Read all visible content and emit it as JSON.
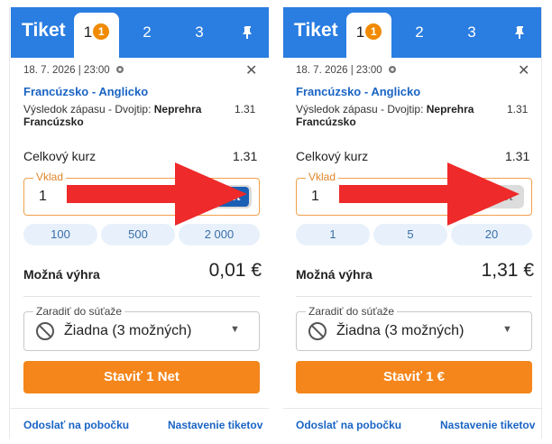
{
  "panels": [
    {
      "header": {
        "title": "Tiket",
        "tabs": [
          "1",
          "2",
          "3"
        ],
        "badge": "1"
      },
      "bet": {
        "datetime": "18. 7. 2026 | 23:00",
        "match": "Francúzsko - Anglicko",
        "market": "Výsledok zápasu - Dvojtip:",
        "selection": "Neprehra Francúzsko",
        "odds": "1.31"
      },
      "total": {
        "label": "Celkový kurz",
        "value": "1.31"
      },
      "stake": {
        "label": "Vklad",
        "value": "1",
        "currency_label": "€",
        "net_label": "Net",
        "active": "Net"
      },
      "quick_stakes": [
        "100",
        "500",
        "2 000"
      ],
      "win": {
        "label": "Možná výhra",
        "value": "0,01 €"
      },
      "competition": {
        "label": "Zaradiť do súťaže",
        "value": "Žiadna (3 možných)"
      },
      "place_button": "Staviť 1 Net",
      "footer": {
        "send": "Odoslať na pobočku",
        "settings": "Nastavenie tiketov"
      }
    },
    {
      "header": {
        "title": "Tiket",
        "tabs": [
          "1",
          "2",
          "3"
        ],
        "badge": "1"
      },
      "bet": {
        "datetime": "18. 7. 2026 | 23:00",
        "match": "Francúzsko - Anglicko",
        "market": "Výsledok zápasu - Dvojtip:",
        "selection": "Neprehra Francúzsko",
        "odds": "1.31"
      },
      "total": {
        "label": "Celkový kurz",
        "value": "1.31"
      },
      "stake": {
        "label": "Vklad",
        "value": "1",
        "currency_label": "€",
        "net_label": "Net",
        "active": "€"
      },
      "quick_stakes": [
        "1",
        "5",
        "20"
      ],
      "win": {
        "label": "Možná výhra",
        "value": "1,31 €"
      },
      "competition": {
        "label": "Zaradiť do súťaže",
        "value": "Žiadna (3 možných)"
      },
      "place_button": "Staviť 1 €",
      "footer": {
        "send": "Odoslať na pobočku",
        "settings": "Nastavenie tiketov"
      }
    }
  ],
  "icons": {
    "pin": "pin-icon",
    "close": "close-icon",
    "ban": "ban-icon",
    "caret": "caret-down-icon",
    "live": "live-icon",
    "arrow": "red-arrow"
  },
  "colors": {
    "header": "#2a7de1",
    "accent": "#f4861b",
    "toggle_active": "#1a5fb4",
    "arrow": "#ee2a2a"
  }
}
